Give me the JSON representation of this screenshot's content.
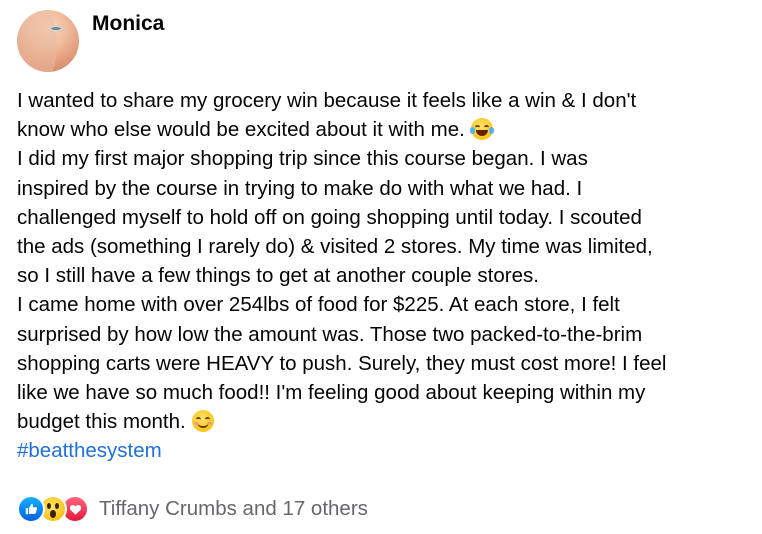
{
  "post": {
    "author": "Monica",
    "paragraphs": [
      "I wanted to share my grocery win because it feels like a win & I don't",
      "know who else would be excited about it with me.",
      "I did my first major shopping trip since this course began. I was",
      "inspired by the course in trying to make do with what we had. I",
      "challenged myself to hold off on going shopping until today. I scouted",
      "the ads (something I rarely do) & visited 2 stores. My time was limited,",
      "so I still have a few things to get at another couple stores.",
      "I came home with over 254lbs of food for $225. At each store, I felt",
      "surprised by how low the amount was. Those two packed-to-the-brim",
      "shopping carts were HEAVY to push. Surely, they must cost more! I feel",
      "like we have so much food!! I'm feeling good about keeping within my",
      "budget this month."
    ],
    "hashtag": "#beatthesystem",
    "emojis": [
      "laughing-tears-emoji",
      "smiling-emoji"
    ]
  },
  "reactions": {
    "icons": [
      "like-icon",
      "wow-icon",
      "love-icon"
    ],
    "summary": "Tiffany Crumbs and 17 others"
  },
  "colors": {
    "hashtag": "#216fdb",
    "secondary_text": "#65676b",
    "like": "#1877f2",
    "love": "#f33e58"
  }
}
